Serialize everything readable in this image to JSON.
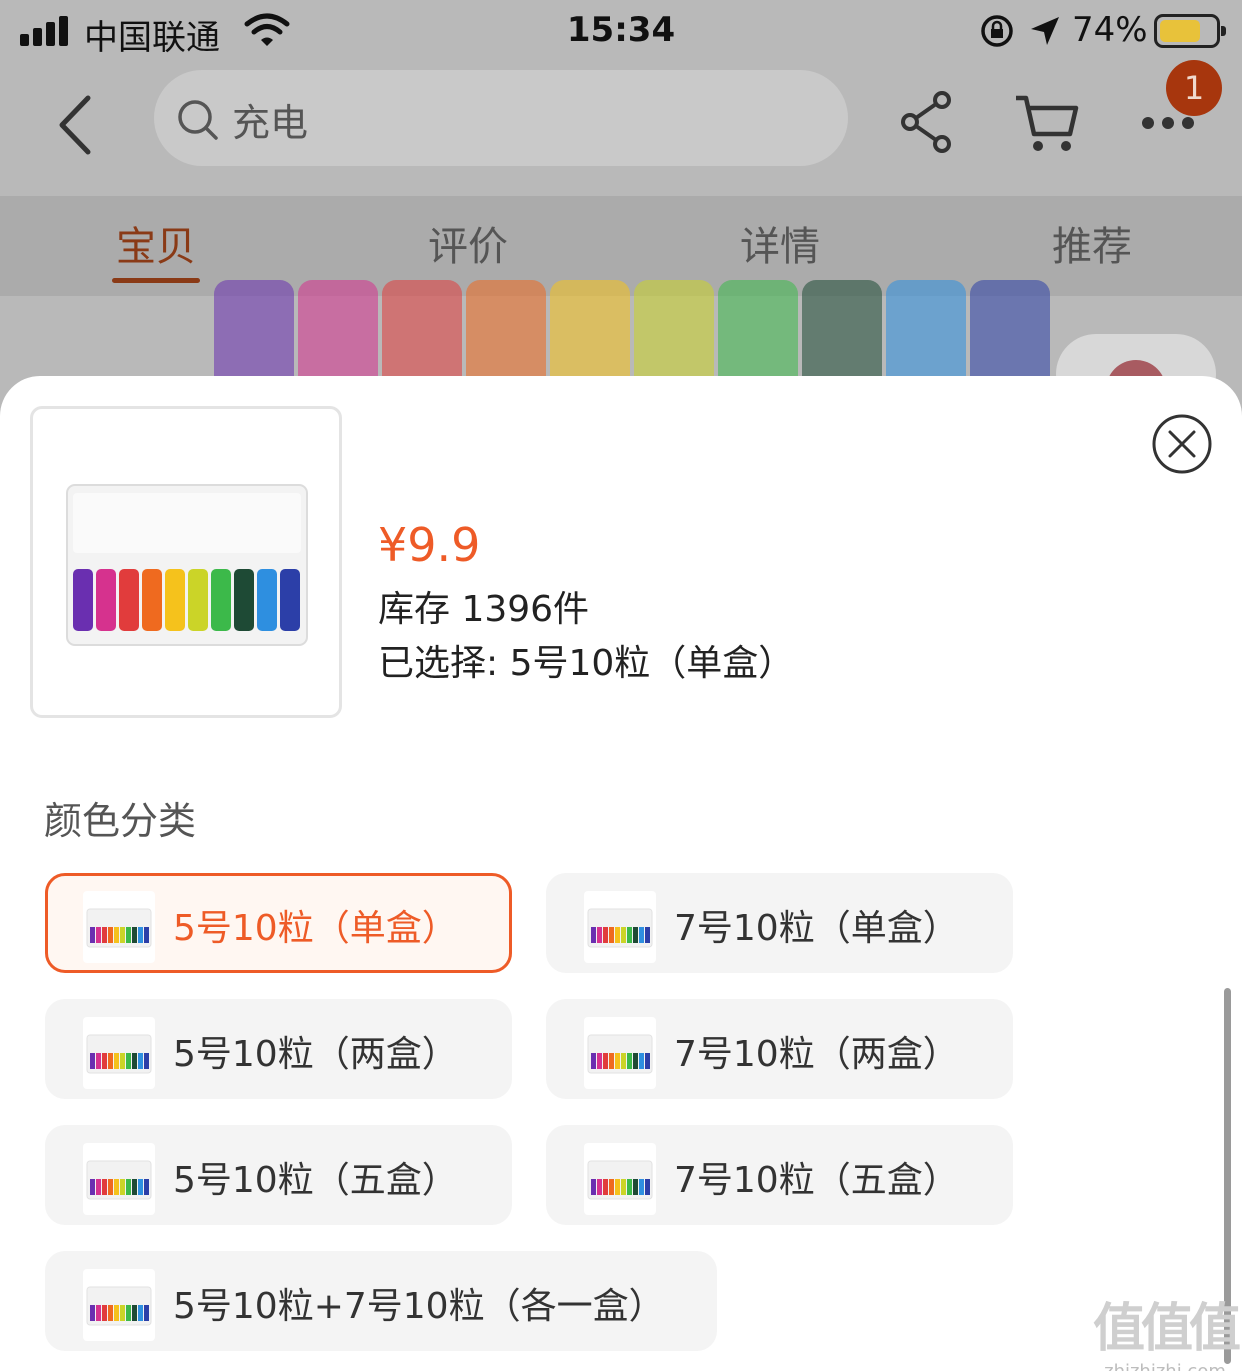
{
  "status_bar": {
    "carrier": "中国联通",
    "time": "15:34",
    "battery_percent": "74%",
    "battery_level": 0.74
  },
  "nav": {
    "search_query": "充电",
    "cart_badge": "1",
    "icons": [
      "back-icon",
      "search-icon",
      "share-icon",
      "cart-icon",
      "more-icon"
    ]
  },
  "tabs": [
    {
      "label": "宝贝",
      "active": true
    },
    {
      "label": "评价",
      "active": false
    },
    {
      "label": "详情",
      "active": false
    },
    {
      "label": "推荐",
      "active": false
    }
  ],
  "sheet": {
    "price": "¥9.9",
    "stock": "库存 1396件",
    "selected": "已选择: 5号10粒（单盒）",
    "section_title": "颜色分类",
    "options": [
      {
        "label": "5号10粒（单盒）",
        "selected": true
      },
      {
        "label": "7号10粒（单盒）",
        "selected": false
      },
      {
        "label": "5号10粒（两盒）",
        "selected": false
      },
      {
        "label": "7号10粒（两盒）",
        "selected": false
      },
      {
        "label": "5号10粒（五盒）",
        "selected": false
      },
      {
        "label": "7号10粒（五盒）",
        "selected": false
      },
      {
        "label": "5号10粒+7号10粒（各一盒）",
        "selected": false
      }
    ]
  },
  "watermark": {
    "big": "值值值",
    "small": "zhizhizhi.com"
  },
  "colors": {
    "accent": "#ee5b27",
    "battery_colors": [
      "#6a2fb0",
      "#d6328e",
      "#e13c3c",
      "#ef6a1f",
      "#f5c21c",
      "#cbd428",
      "#3cb94a",
      "#1e4a35",
      "#2e8fe0",
      "#2c3fa8"
    ]
  }
}
